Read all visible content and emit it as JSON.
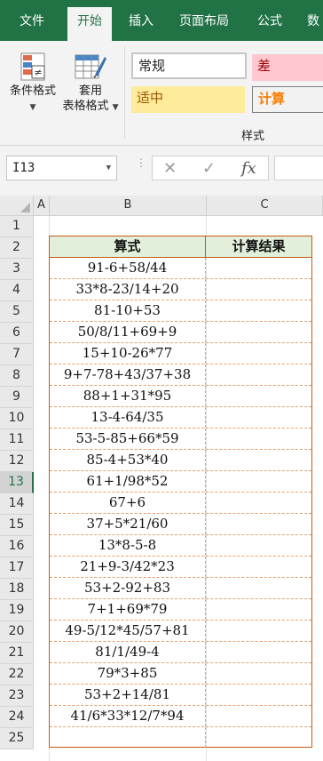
{
  "tabs": [
    "文件",
    "开始",
    "插入",
    "页面布局",
    "公式",
    "数"
  ],
  "active_tab": "开始",
  "ribbon": {
    "conditional_format": "条件格式",
    "table_format_1": "套用",
    "table_format_2": "表格格式",
    "styles": {
      "normal": "常规",
      "bad": "差",
      "neutral": "适中",
      "calc": "计算"
    },
    "group_label": "样式"
  },
  "formula_bar": {
    "name_box": "I13",
    "cancel_icon": "✕",
    "enter_icon": "✓",
    "fx": "fx"
  },
  "columns": [
    "A",
    "B",
    "C"
  ],
  "rows": [
    "1",
    "2",
    "3",
    "4",
    "5",
    "6",
    "7",
    "8",
    "9",
    "10",
    "11",
    "12",
    "13",
    "14",
    "15",
    "16",
    "17",
    "18",
    "19",
    "20",
    "21",
    "22",
    "23",
    "24",
    "25"
  ],
  "selected_row": "13",
  "table": {
    "header": [
      "算式",
      "计算结果"
    ],
    "expressions": [
      "91-6+58/44",
      "33*8-23/14+20",
      "81-10+53",
      "50/8/11+69+9",
      "15+10-26*77",
      "9+7-78+43/37+38",
      "88+1+31*95",
      "13-4-64/35",
      "53-5-85+66*59",
      "85-4+53*40",
      "61+1/98*52",
      "67+6",
      "37+5*21/60",
      "13*8-5-8",
      "21+9-3/42*23",
      "53+2-92+83",
      "7+1+69*79",
      "49-5/12*45/57+81",
      "81/1/49-4",
      "79*3+85",
      "53+2+14/81",
      "41/6*33*12/7*94"
    ]
  },
  "colors": {
    "ribbon_green": "#217346",
    "table_border": "#c55a11",
    "header_fill": "#e2efda"
  }
}
